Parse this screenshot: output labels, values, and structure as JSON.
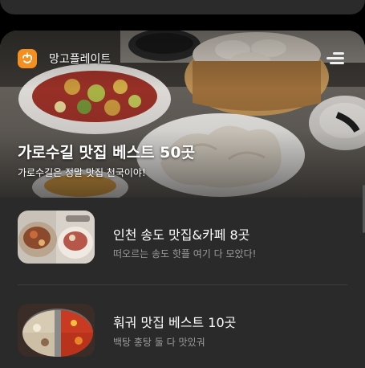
{
  "header": {
    "brand_name": "망고플레이트",
    "brand_logo_icon": "mangoplate-logo-icon",
    "menu_icon": "menu-icon",
    "brand_color": "#f4901f"
  },
  "featured": {
    "title": "가로수길 맛집 베스트 50곳",
    "subtitle": "가로수길은 정말 맛집 천국이야!"
  },
  "list": {
    "items": [
      {
        "title": "인천 송도 맛집&카페 8곳",
        "subtitle": "떠오르는 송도 핫플 여기 다 모았다!"
      },
      {
        "title": "훠궈 맛집 베스트 10곳",
        "subtitle": "백탕 홍탕 둘 다 맛있궈"
      }
    ]
  }
}
